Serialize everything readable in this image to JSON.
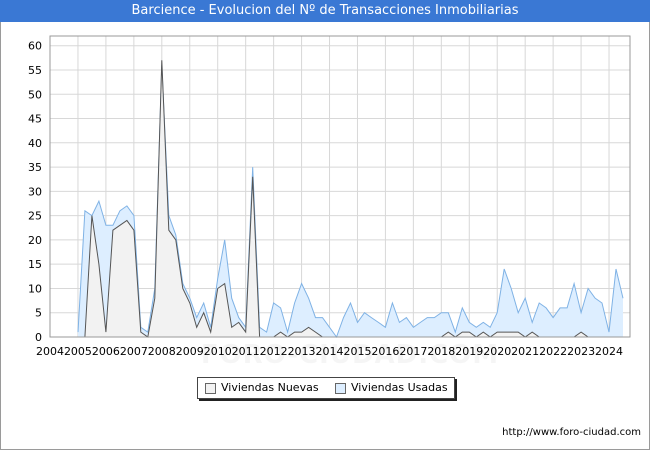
{
  "title": "Barcience - Evolucion del Nº de Transacciones Inmobiliarias",
  "source": "http://www.foro-ciudad.com",
  "watermark": "FORO-CIUDAD.COM",
  "colors": {
    "title_bg": "#3a78d4",
    "nuevas_fill": "#f2f2f2",
    "nuevas_line": "#555555",
    "usadas_fill": "#ddeeff",
    "usadas_line": "#7fb2e5",
    "grid": "#d8d8d8"
  },
  "chart_data": {
    "type": "area",
    "title": "Barcience - Evolucion del Nº de Transacciones Inmobiliarias",
    "xlabel": "",
    "ylabel": "",
    "xlim": [
      2004,
      2024.75
    ],
    "ylim": [
      0,
      62
    ],
    "y_ticks": [
      0,
      5,
      10,
      15,
      20,
      25,
      30,
      35,
      40,
      45,
      50,
      55,
      60
    ],
    "x_tick_labels": [
      "2004",
      "2005",
      "2006",
      "2007",
      "2008",
      "2009",
      "2010",
      "2011",
      "2012",
      "2013",
      "2014",
      "2015",
      "2016",
      "2017",
      "2018",
      "2019",
      "2020",
      "2021",
      "2022",
      "2023",
      "2024"
    ],
    "grid": true,
    "legend_position": "bottom-center",
    "x": [
      2005.0,
      2005.25,
      2005.5,
      2005.75,
      2006.0,
      2006.25,
      2006.5,
      2006.75,
      2007.0,
      2007.25,
      2007.5,
      2007.75,
      2008.0,
      2008.25,
      2008.5,
      2008.75,
      2009.0,
      2009.25,
      2009.5,
      2009.75,
      2010.0,
      2010.25,
      2010.5,
      2010.75,
      2011.0,
      2011.25,
      2011.5,
      2011.75,
      2012.0,
      2012.25,
      2012.5,
      2012.75,
      2013.0,
      2013.25,
      2013.5,
      2013.75,
      2014.0,
      2014.25,
      2014.5,
      2014.75,
      2015.0,
      2015.25,
      2015.5,
      2015.75,
      2016.0,
      2016.25,
      2016.5,
      2016.75,
      2017.0,
      2017.25,
      2017.5,
      2017.75,
      2018.0,
      2018.25,
      2018.5,
      2018.75,
      2019.0,
      2019.25,
      2019.5,
      2019.75,
      2020.0,
      2020.25,
      2020.5,
      2020.75,
      2021.0,
      2021.25,
      2021.5,
      2021.75,
      2022.0,
      2022.25,
      2022.5,
      2022.75,
      2023.0,
      2023.25,
      2023.5,
      2023.75,
      2024.0,
      2024.25,
      2024.5
    ],
    "series": [
      {
        "name": "Viviendas Nuevas",
        "values": [
          0,
          0,
          25,
          15,
          1,
          22,
          23,
          24,
          22,
          1,
          0,
          8,
          57,
          22,
          20,
          10,
          7,
          2,
          5,
          1,
          10,
          11,
          2,
          3,
          1,
          33,
          0,
          0,
          0,
          1,
          0,
          1,
          1,
          2,
          1,
          0,
          0,
          0,
          0,
          0,
          0,
          0,
          0,
          0,
          0,
          0,
          0,
          0,
          0,
          0,
          0,
          0,
          0,
          1,
          0,
          1,
          1,
          0,
          1,
          0,
          1,
          1,
          1,
          1,
          0,
          1,
          0,
          0,
          0,
          0,
          0,
          0,
          1,
          0,
          0,
          0,
          0,
          0,
          0
        ]
      },
      {
        "name": "Viviendas Usadas",
        "values": [
          1,
          26,
          25,
          28,
          23,
          23,
          26,
          27,
          25,
          2,
          1,
          10,
          56,
          25,
          21,
          11,
          8,
          4,
          7,
          2,
          12,
          20,
          8,
          4,
          2,
          35,
          2,
          1,
          7,
          6,
          1,
          7,
          11,
          8,
          4,
          4,
          2,
          0,
          4,
          7,
          3,
          5,
          4,
          3,
          2,
          7,
          3,
          4,
          2,
          3,
          4,
          4,
          5,
          5,
          1,
          6,
          3,
          2,
          3,
          2,
          5,
          14,
          10,
          5,
          8,
          3,
          7,
          6,
          4,
          6,
          6,
          11,
          5,
          10,
          8,
          7,
          1,
          14,
          8
        ]
      }
    ]
  }
}
